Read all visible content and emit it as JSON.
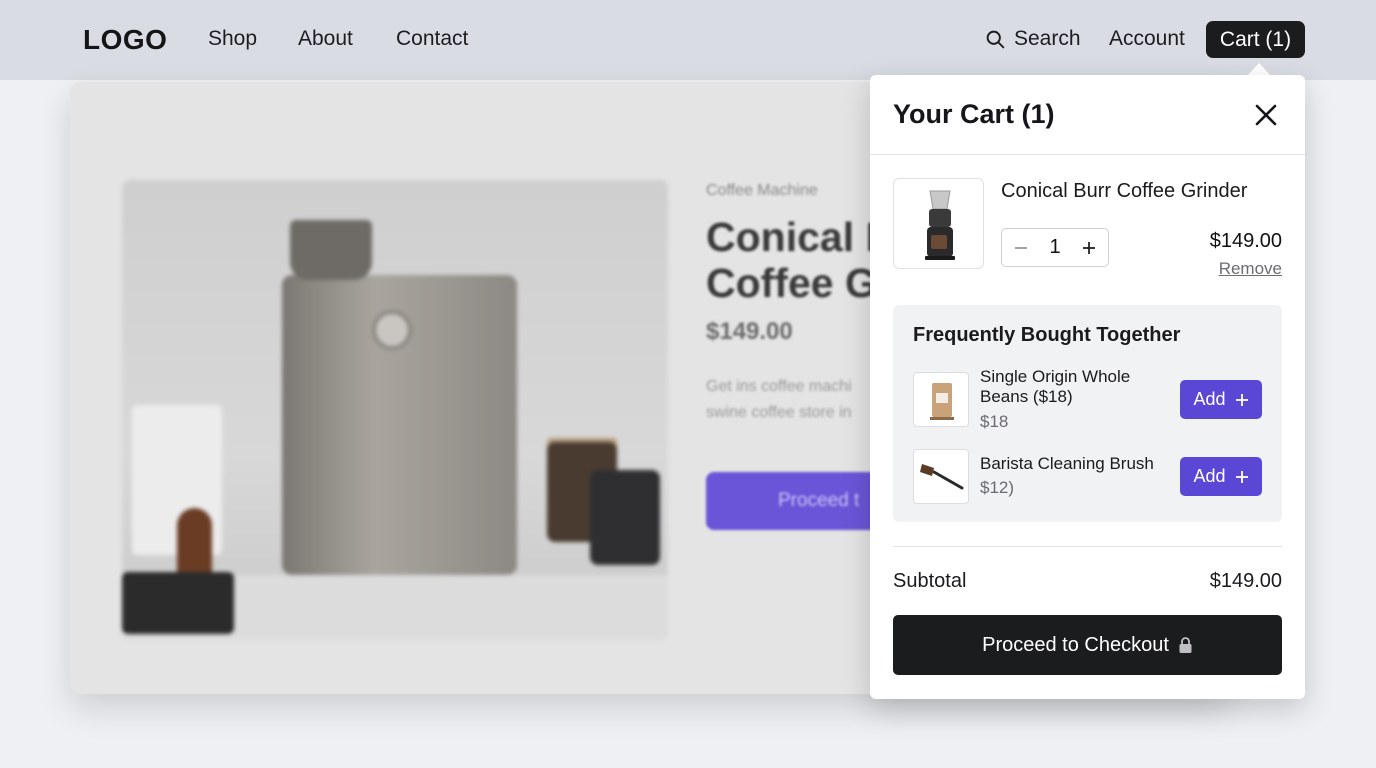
{
  "header": {
    "logo": "LOGO",
    "nav": [
      "Shop",
      "About",
      "Contact"
    ],
    "search_label": "Search",
    "account_label": "Account",
    "cart_label": "Cart (1)"
  },
  "product": {
    "category": "Coffee Machine",
    "title_line1": "Conical B",
    "title_line2": "Coffee G",
    "price": "$149.00",
    "desc_line1": "Get ins coffee machi",
    "desc_line2": "swine coffee store in",
    "cta": "Proceed t"
  },
  "cart": {
    "title": "Your Cart (1)",
    "item": {
      "name": "Conical Burr Coffee Grinder",
      "quantity": "1",
      "price": "$149.00",
      "remove_label": "Remove"
    },
    "fbt": {
      "title": "Frequently Bought Together",
      "items": [
        {
          "name": "Single Origin Whole Beans ($18)",
          "price": "$18",
          "add_label": "Add"
        },
        {
          "name": "Barista Cleaning Brush",
          "price": "$12)",
          "add_label": "Add"
        }
      ]
    },
    "subtotal_label": "Subtotal",
    "subtotal_value": "$149.00",
    "checkout_label": "Proceed to Checkout"
  },
  "colors": {
    "accent": "#5b47d6",
    "dark_button": "#1b1c1e",
    "header_bg": "#d9dde3"
  }
}
